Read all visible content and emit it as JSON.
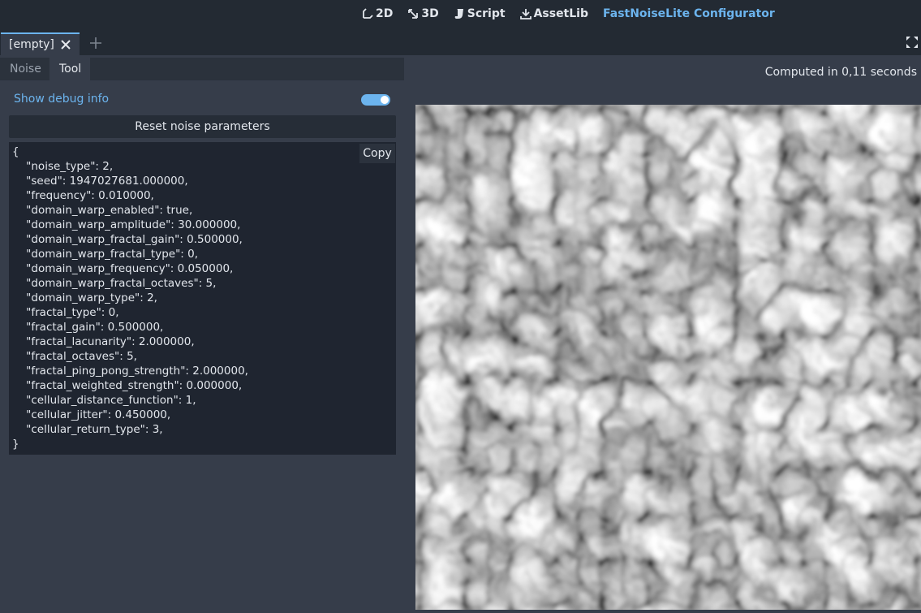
{
  "workspaces": [
    {
      "label": "2D",
      "icon": "2d-workspace-icon"
    },
    {
      "label": "3D",
      "icon": "3d-workspace-icon"
    },
    {
      "label": "Script",
      "icon": "script-icon"
    },
    {
      "label": "AssetLib",
      "icon": "download-icon"
    },
    {
      "label": "FastNoiseLite Configurator",
      "icon": "",
      "active": true
    }
  ],
  "scene_tab": {
    "label": "[empty]"
  },
  "panel": {
    "tabs": [
      "Noise",
      "Tool"
    ],
    "active_tab": "Tool",
    "debug_label": "Show debug info",
    "debug_enabled": true,
    "reset_label": "Reset noise parameters",
    "copy_label": "Copy",
    "code_lines": [
      "{",
      "    \"noise_type\": 2,",
      "    \"seed\": 1947027681.000000,",
      "    \"frequency\": 0.010000,",
      "    \"domain_warp_enabled\": true,",
      "    \"domain_warp_amplitude\": 30.000000,",
      "    \"domain_warp_fractal_gain\": 0.500000,",
      "    \"domain_warp_fractal_type\": 0,",
      "    \"domain_warp_frequency\": 0.050000,",
      "    \"domain_warp_fractal_octaves\": 5,",
      "    \"domain_warp_type\": 2,",
      "    \"fractal_type\": 0,",
      "    \"fractal_gain\": 0.500000,",
      "    \"fractal_lacunarity\": 2.000000,",
      "    \"fractal_octaves\": 5,",
      "    \"fractal_ping_pong_strength\": 2.000000,",
      "    \"fractal_weighted_strength\": 0.000000,",
      "    \"cellular_distance_function\": 1,",
      "    \"cellular_jitter\": 0.450000,",
      "    \"cellular_return_type\": 3,",
      "}"
    ]
  },
  "status": "Computed in 0,11 seconds",
  "colors": {
    "accent": "#6cb4ee",
    "background": "#363d4a",
    "topbar": "#232a33"
  }
}
